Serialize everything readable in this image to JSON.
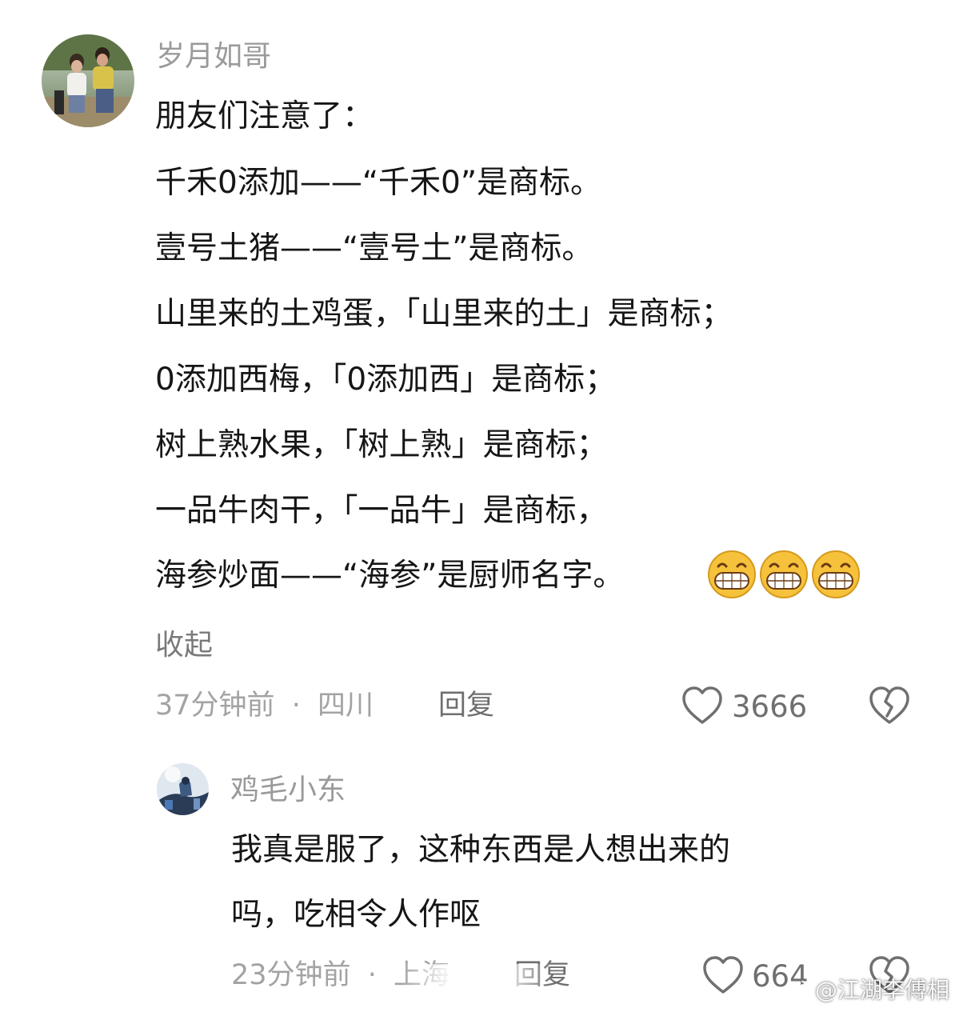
{
  "comment1": {
    "username": "岁月如哥",
    "lines": [
      "朋友们注意了：",
      "千禾0添加——“千禾0”是商标。",
      "壹号土猪——“壹号土”是商标。",
      "山里来的土鸡蛋，「山里来的土」是商标；",
      "0添加西梅，「0添加西」是商标；",
      "树上熟水果，「树上熟」是商标；",
      "一品牛肉干，「一品牛」是商标，",
      "海参炒面——“海参”是厨师名字。"
    ],
    "emoji": "grinning-emoji",
    "collapse_label": "收起",
    "time": "37分钟前",
    "separator": "·",
    "location": "四川",
    "reply_label": "回复",
    "like_count": "3666"
  },
  "comment2": {
    "username": "鸡毛小东",
    "lines": [
      "我真是服了，这种东西是人想出来的",
      "吗，吃相令人作呕"
    ],
    "time": "23分钟前",
    "separator": "·",
    "location": "上海",
    "reply_label": "回复",
    "like_count": "664"
  },
  "watermark": {
    "text": "@江湖李傅相"
  },
  "colors": {
    "username": "#9a9a9a",
    "meta": "#a3a3a3",
    "body": "#161616",
    "icon": "#707070"
  }
}
